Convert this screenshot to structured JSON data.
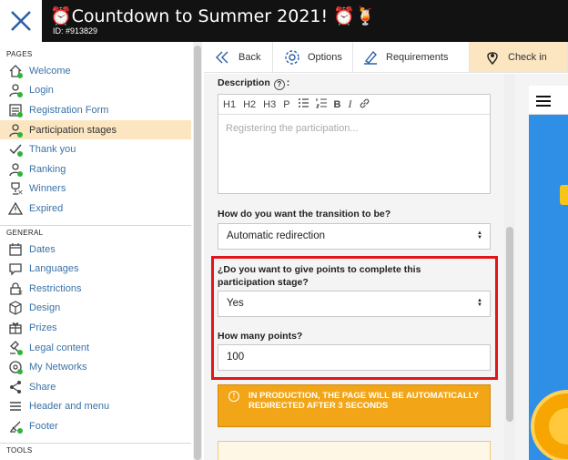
{
  "header": {
    "title": "⏰Countdown to Summer 2021! ⏰🍹",
    "id": "ID: #913829"
  },
  "sidebar": {
    "pages_label": "PAGES",
    "pages": [
      {
        "label": "Welcome",
        "icon": "home-icon"
      },
      {
        "label": "Login",
        "icon": "user-icon"
      },
      {
        "label": "Registration Form",
        "icon": "form-icon"
      },
      {
        "label": "Participation stages",
        "icon": "user-icon",
        "active": true
      },
      {
        "label": "Thank you",
        "icon": "check-icon"
      },
      {
        "label": "Ranking",
        "icon": "user-icon"
      },
      {
        "label": "Winners",
        "icon": "trophy-icon"
      },
      {
        "label": "Expired",
        "icon": "warning-icon"
      }
    ],
    "general_label": "GENERAL",
    "general": [
      {
        "label": "Dates",
        "icon": "calendar-icon"
      },
      {
        "label": "Languages",
        "icon": "chat-icon"
      },
      {
        "label": "Restrictions",
        "icon": "lock-icon"
      },
      {
        "label": "Design",
        "icon": "cube-icon"
      },
      {
        "label": "Prizes",
        "icon": "gift-icon"
      },
      {
        "label": "Legal content",
        "icon": "gavel-icon"
      },
      {
        "label": "My Networks",
        "icon": "network-icon"
      },
      {
        "label": "Share",
        "icon": "share-icon"
      },
      {
        "label": "Header and menu",
        "icon": "menu-icon"
      },
      {
        "label": "Footer",
        "icon": "footer-icon"
      }
    ],
    "tools_label": "TOOLS"
  },
  "tabs": {
    "back": "Back",
    "options": "Options",
    "requirements": "Requirements",
    "check_in": "Check in"
  },
  "form": {
    "description_label": "Description",
    "description_suffix": ":",
    "toolbar": {
      "h1": "H1",
      "h2": "H2",
      "h3": "H3",
      "p": "P",
      "bold": "B",
      "italic": "I"
    },
    "description_placeholder": "Registering the participation...",
    "transition_label": "How do you want the transition to be?",
    "transition_value": "Automatic redirection",
    "points_question": "¿Do you want to give points to complete this participation stage?",
    "points_answer": "Yes",
    "points_count_label": "How many points?",
    "points_count_value": "100",
    "warning": "IN PRODUCTION, THE PAGE WILL BE AUTOMATICALLY REDIRECTED AFTER 3 SECONDS"
  },
  "colors": {
    "header_bg": "#121212",
    "active_bg": "#fce5c1",
    "link": "#3b72a8",
    "warning_bg": "#f2a516",
    "highlight": "#e0161b"
  }
}
